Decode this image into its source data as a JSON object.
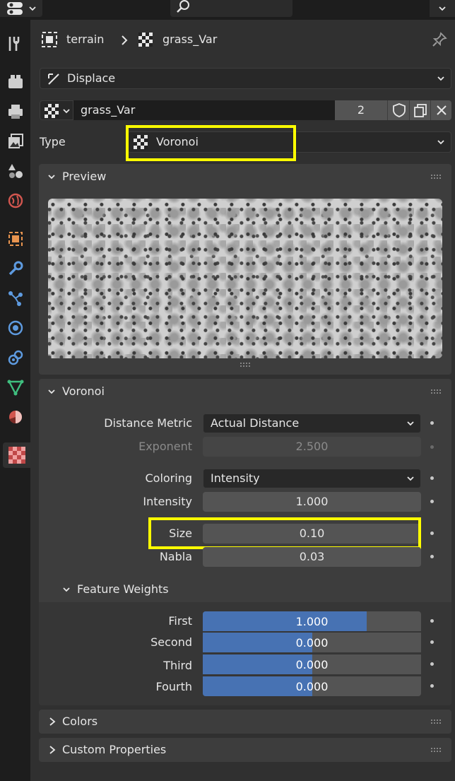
{
  "breadcrumb": {
    "object": "terrain",
    "texture": "grass_Var"
  },
  "modifier": {
    "name": "Displace"
  },
  "texture_block": {
    "name": "grass_Var",
    "users": "2"
  },
  "type_row": {
    "label": "Type",
    "value": "Voronoi"
  },
  "preview_panel": {
    "title": "Preview"
  },
  "voronoi_panel": {
    "title": "Voronoi",
    "distance_metric": {
      "label": "Distance Metric",
      "value": "Actual Distance"
    },
    "exponent": {
      "label": "Exponent",
      "value": "2.500"
    },
    "coloring": {
      "label": "Coloring",
      "value": "Intensity"
    },
    "intensity": {
      "label": "Intensity",
      "value": "1.000"
    },
    "size": {
      "label": "Size",
      "value": "0.10"
    },
    "nabla": {
      "label": "Nabla",
      "value": "0.03"
    }
  },
  "feature_weights": {
    "title": "Feature Weights",
    "first": {
      "label": "First",
      "value": "1.000",
      "fill": 0.75
    },
    "second": {
      "label": "Second",
      "value": "0.000",
      "fill": 0.5
    },
    "third": {
      "label": "Third",
      "value": "0.000",
      "fill": 0.5
    },
    "fourth": {
      "label": "Fourth",
      "value": "0.000",
      "fill": 0.5
    }
  },
  "colors_panel": {
    "title": "Colors"
  },
  "custom_props_panel": {
    "title": "Custom Properties"
  },
  "colors": {
    "accent": "#4772b3",
    "highlight": "#ffff00",
    "bg": "#303030",
    "panel": "#3d3d3d"
  },
  "icons": [
    "editor-type-icon",
    "search-icon",
    "chevron-down-icon",
    "tool-icon",
    "render-icon",
    "output-icon",
    "view-layer-icon",
    "scene-icon",
    "world-icon",
    "object-icon",
    "modifier-icon",
    "particles-icon",
    "physics-icon",
    "constraints-icon",
    "data-icon",
    "material-icon",
    "texture-icon",
    "pin-icon",
    "fake-user-icon",
    "duplicate-icon",
    "close-icon",
    "checker-icon"
  ]
}
